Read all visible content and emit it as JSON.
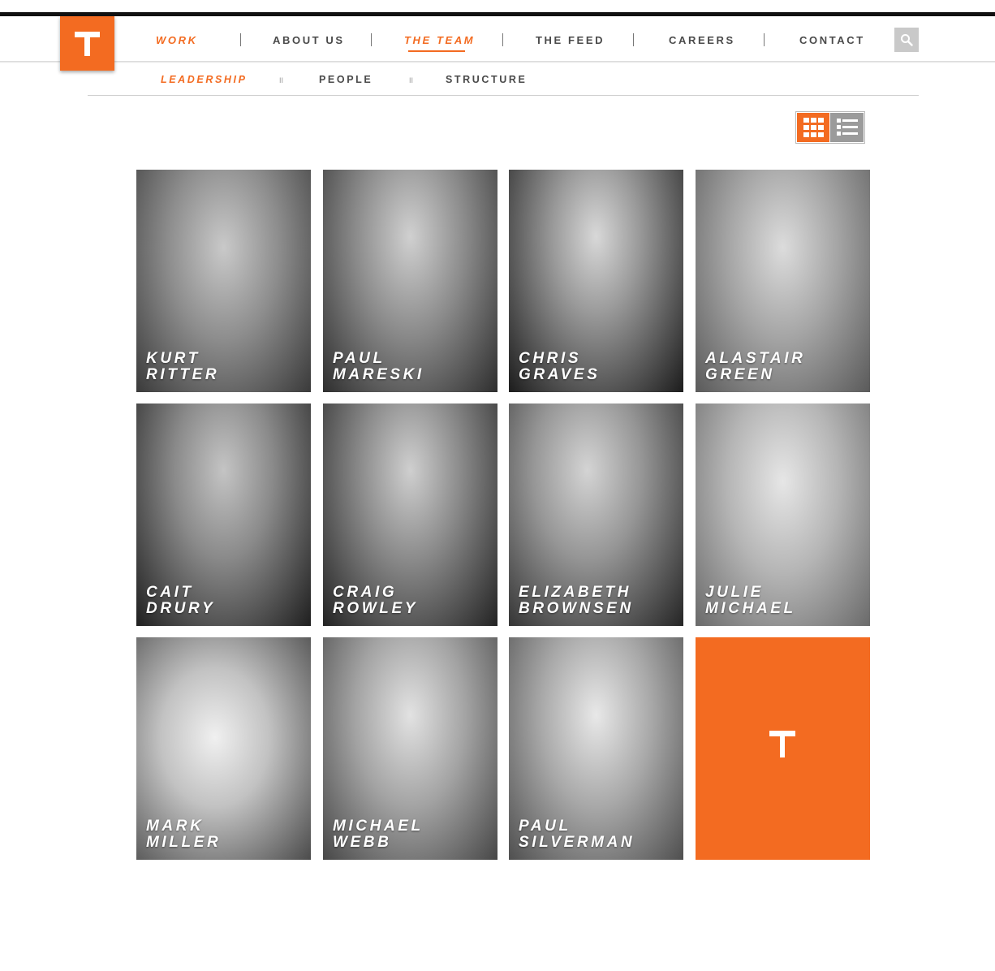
{
  "nav": {
    "items": [
      {
        "label": "WORK",
        "active": true
      },
      {
        "label": "ABOUT US",
        "active": false
      },
      {
        "label": "THE TEAM",
        "active": true
      },
      {
        "label": "THE FEED",
        "active": false
      },
      {
        "label": "CAREERS",
        "active": false
      },
      {
        "label": "CONTACT",
        "active": false
      }
    ]
  },
  "subnav": {
    "items": [
      {
        "label": "LEADERSHIP",
        "active": true
      },
      {
        "label": "PEOPLE",
        "active": false
      },
      {
        "label": "STRUCTURE",
        "active": false
      }
    ],
    "separator": "II"
  },
  "view_toggle": {
    "selected": "grid",
    "icons": [
      "grid-icon",
      "list-icon"
    ]
  },
  "team": [
    {
      "first": "KURT",
      "last": "RITTER"
    },
    {
      "first": "PAUL",
      "last": "MARESKI"
    },
    {
      "first": "CHRIS",
      "last": "GRAVES"
    },
    {
      "first": "ALASTAIR",
      "last": "GREEN"
    },
    {
      "first": "CAIT",
      "last": "DRURY"
    },
    {
      "first": "CRAIG",
      "last": "ROWLEY"
    },
    {
      "first": "ELIZABETH",
      "last": "BROWNSEN"
    },
    {
      "first": "JULIE",
      "last": "MICHAEL"
    },
    {
      "first": "MARK",
      "last": "MILLER"
    },
    {
      "first": "MICHAEL",
      "last": "WEBB"
    },
    {
      "first": "PAUL",
      "last": "SILVERMAN"
    }
  ],
  "colors": {
    "accent": "#f36b21",
    "text": "#4a4a4a",
    "toggle_inactive": "#9b9b9b",
    "search_bg": "#c9c9c9"
  }
}
